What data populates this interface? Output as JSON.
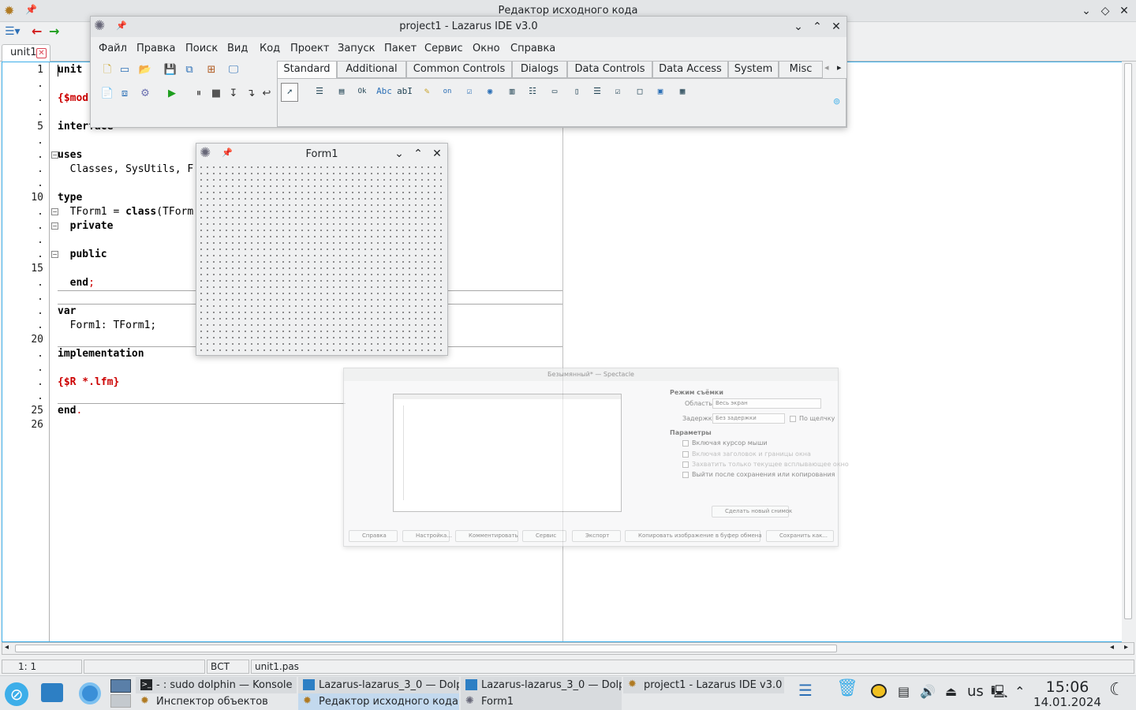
{
  "editor_window": {
    "title": "Редактор исходного кода"
  },
  "editor_tab": {
    "label": "unit1"
  },
  "line_numbers": [
    "1",
    ".",
    ".",
    "5",
    ".",
    ".",
    ".",
    ".",
    ".",
    "10",
    ".",
    ".",
    ".",
    ".",
    "15",
    ".",
    ".",
    ".",
    ".",
    "20",
    ".",
    ".",
    ".",
    ".",
    "25",
    "26"
  ],
  "code": {
    "l1": "unit",
    "l2": "{$mod",
    "l5": "interface",
    "l7": "uses",
    "l8a": "  Classes, SysUtils, F",
    "l10": "type",
    "l11a": "  TForm1 = ",
    "l11b": "class",
    "l11c": "(TForm",
    "l12": "  private",
    "l14": "  public",
    "l16a": "  end",
    "l16b": ";",
    "l18": "var",
    "l19": "  Form1: TForm1;",
    "l21": "implementation",
    "l23": "{$R *.lfm}",
    "l25a": "end",
    "l25b": "."
  },
  "status_bar": {
    "position": "1: 1",
    "empty": "",
    "mode": "ВСТ",
    "file": "unit1.pas"
  },
  "ide_window": {
    "title": "project1 - Lazarus IDE v3.0",
    "menu": [
      "Файл",
      "Правка",
      "Поиск",
      "Вид",
      "Код",
      "Проект",
      "Запуск",
      "Пакет",
      "Сервис",
      "Окно",
      "Справка"
    ],
    "palette_tabs": [
      "Standard",
      "Additional",
      "Common Controls",
      "Dialogs",
      "Data Controls",
      "Data Access",
      "System",
      "Misc"
    ],
    "palette_tab_active": "Standard",
    "palette_icons": [
      "Ok",
      "Abc",
      "abI",
      "on"
    ]
  },
  "form1_window": {
    "title": "Form1"
  },
  "spectacle_window": {
    "title": "Безымянный* — Spectacle",
    "section_mode": "Режим съёмки",
    "area_label": "Область:",
    "area_value": "Весь экран",
    "delay_label": "Задержка:",
    "delay_value": "Без задержки",
    "on_click": "По щелчку",
    "section_params": "Параметры",
    "opt1": "Включая курсор мыши",
    "opt2": "Включая заголовок и границы окна",
    "opt3": "Захватить только текущее всплывающее окно",
    "opt4": "Выйти после сохранения или копирования",
    "new_shot": "Сделать новый снимок",
    "btn_help": "Справка",
    "btn_settings": "Настройка...",
    "btn_annotate": "Комментировать",
    "btn_tools": "Сервис",
    "btn_export": "Экспорт",
    "btn_copy": "Копировать изображение в буфер обмена",
    "btn_save": "Сохранить как..."
  },
  "taskbar": {
    "tasks": [
      {
        "label": "- : sudo dolphin — Konsole"
      },
      {
        "label": "Lazarus-lazarus_3_0 — Dolp..."
      },
      {
        "label": "Lazarus-lazarus_3_0 — Dolp..."
      },
      {
        "label": "project1 - Lazarus IDE v3.0"
      },
      {
        "label": "Инспектор объектов"
      },
      {
        "label": "Редактор исходного кода"
      },
      {
        "label": "Form1"
      }
    ],
    "keyboard_layout": "us",
    "time": "15:06",
    "date": "14.01.2024"
  },
  "colors": {
    "accent": "#3daee9",
    "directive": "#cc0000",
    "active_task": "#c3d9ee"
  }
}
